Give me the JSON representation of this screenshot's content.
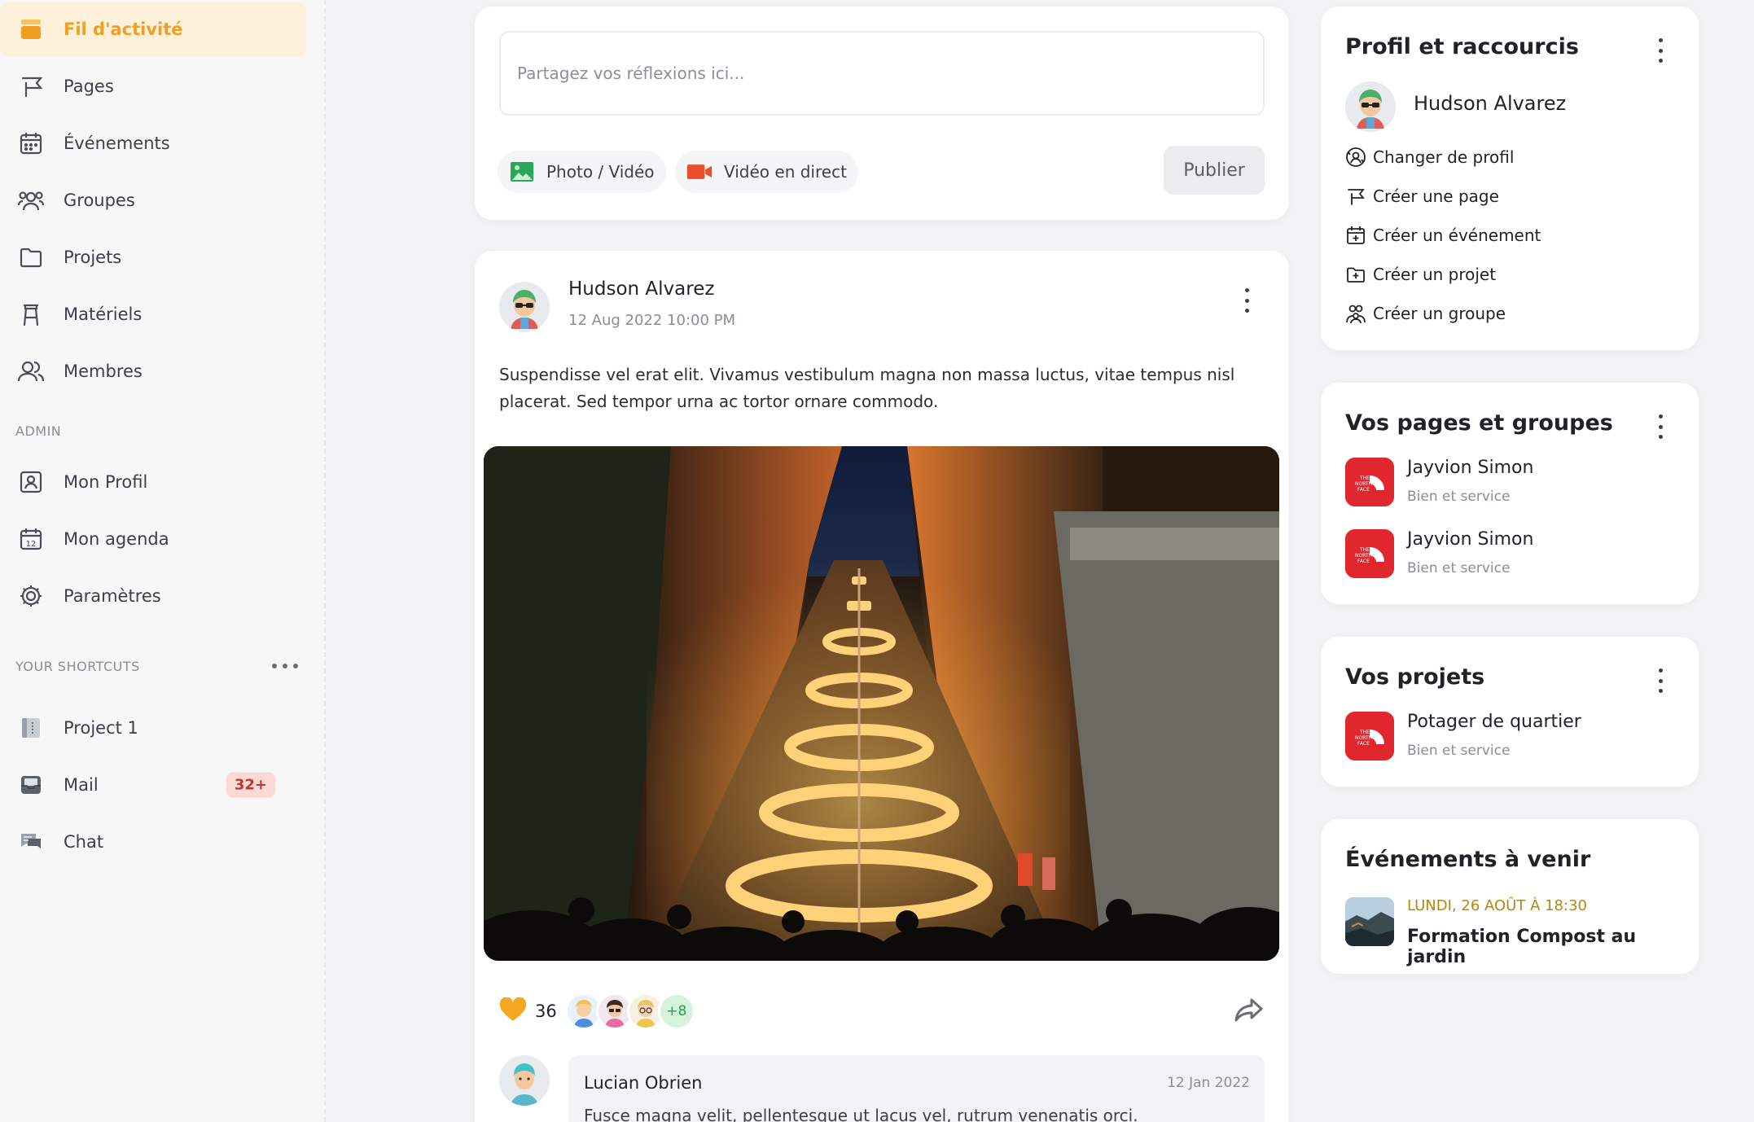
{
  "sidebar": {
    "nav": [
      {
        "label": "Fil d'activité",
        "icon": "layers-icon",
        "active": true
      },
      {
        "label": "Pages",
        "icon": "flag-icon"
      },
      {
        "label": "Événements",
        "icon": "calendar-icon"
      },
      {
        "label": "Groupes",
        "icon": "users-group-icon"
      },
      {
        "label": "Projets",
        "icon": "folder-icon"
      },
      {
        "label": "Matériels",
        "icon": "stool-icon"
      },
      {
        "label": "Membres",
        "icon": "members-icon"
      }
    ],
    "admin_title": "ADMIN",
    "admin": [
      {
        "label": "Mon Profil",
        "icon": "profile-icon"
      },
      {
        "label": "Mon agenda",
        "icon": "agenda-icon"
      },
      {
        "label": "Paramètres",
        "icon": "gear-icon"
      }
    ],
    "shortcuts_title": "YOUR SHORTCUTS",
    "shortcuts": [
      {
        "label": "Project 1",
        "icon": "notebook-icon"
      },
      {
        "label": "Mail",
        "icon": "inbox-icon",
        "badge": "32+"
      },
      {
        "label": "Chat",
        "icon": "chat-icon"
      }
    ]
  },
  "composer": {
    "placeholder": "Partagez vos réflexions ici...",
    "photo_label": "Photo / Vidéo",
    "live_label": "Vidéo en direct",
    "publish_label": "Publier"
  },
  "post": {
    "author": "Hudson Alvarez",
    "date": "12 Aug 2022 10:00 PM",
    "text_line1": "Suspendisse vel erat elit. Vivamus vestibulum magna non massa luctus, vitae tempus nisl",
    "text_line2": "placerat. Sed tempor urna ac tortor ornare commodo.",
    "likes": "36",
    "more_reactors": "+8",
    "comment": {
      "author": "Lucian Obrien",
      "date": "12 Jan 2022",
      "text": "Fusce magna velit, pellentesque ut lacus vel, rutrum venenatis orci."
    }
  },
  "profile_card": {
    "title": "Profil et raccourcis",
    "name": "Hudson Alvarez",
    "links": [
      {
        "label": "Changer de profil",
        "icon": "switch-user-icon"
      },
      {
        "label": "Créer une page",
        "icon": "flag-icon"
      },
      {
        "label": "Créer un événement",
        "icon": "calendar-plus-icon"
      },
      {
        "label": "Créer un projet",
        "icon": "folder-plus-icon"
      },
      {
        "label": "Créer un groupe",
        "icon": "users-group-icon"
      }
    ]
  },
  "pages_card": {
    "title": "Vos pages et groupes",
    "items": [
      {
        "name": "Jayvion Simon",
        "sub": "Bien et service"
      },
      {
        "name": "Jayvion Simon",
        "sub": "Bien et service"
      }
    ]
  },
  "projects_card": {
    "title": "Vos projets",
    "items": [
      {
        "name": "Potager de quartier",
        "sub": "Bien et service"
      }
    ]
  },
  "events_card": {
    "title": "Événements à venir",
    "date": "LUNDI, 26 AOÛT À 18:30",
    "name": "Formation Compost au jardin"
  },
  "logo_text": "THE NORTH FACE",
  "colors": {
    "accent": "#f0a020",
    "active_bg": "#fdf1dc",
    "badge_bg": "#fbd9d6",
    "badge_text": "#c5352d",
    "brand_red": "#e1262d",
    "event_date": "#b8860b"
  }
}
